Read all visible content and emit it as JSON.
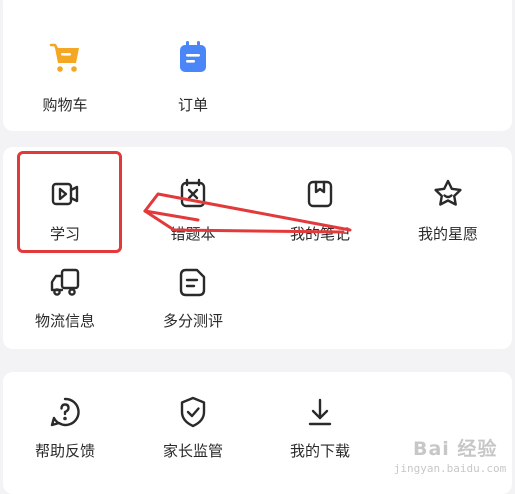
{
  "section_orders": {
    "items": [
      {
        "label": "购物车",
        "icon": "shopping-cart-icon"
      },
      {
        "label": "订单",
        "icon": "order-notebook-icon"
      }
    ]
  },
  "section_tools": {
    "items": [
      {
        "label": "学习",
        "icon": "video-study-icon"
      },
      {
        "label": "错题本",
        "icon": "wrong-question-book-icon"
      },
      {
        "label": "我的笔记",
        "icon": "notes-icon"
      },
      {
        "label": "我的星愿",
        "icon": "star-wish-icon"
      },
      {
        "label": "物流信息",
        "icon": "delivery-truck-icon"
      },
      {
        "label": "多分测评",
        "icon": "evaluation-doc-icon"
      }
    ]
  },
  "section_service": {
    "items": [
      {
        "label": "帮助反馈",
        "icon": "help-question-icon"
      },
      {
        "label": "家长监管",
        "icon": "shield-check-icon"
      },
      {
        "label": "我的下载",
        "icon": "download-icon"
      }
    ]
  },
  "annotation": {
    "highlight_color": "#e23a3a",
    "highlighted_item": "学习"
  },
  "watermark": {
    "main": "Bai 经验",
    "sub": "jingyan.baidu.com"
  },
  "colors": {
    "cart_orange": "#f5a623",
    "order_blue": "#4a86f7",
    "background": "#f3f3f5",
    "card": "#ffffff"
  }
}
